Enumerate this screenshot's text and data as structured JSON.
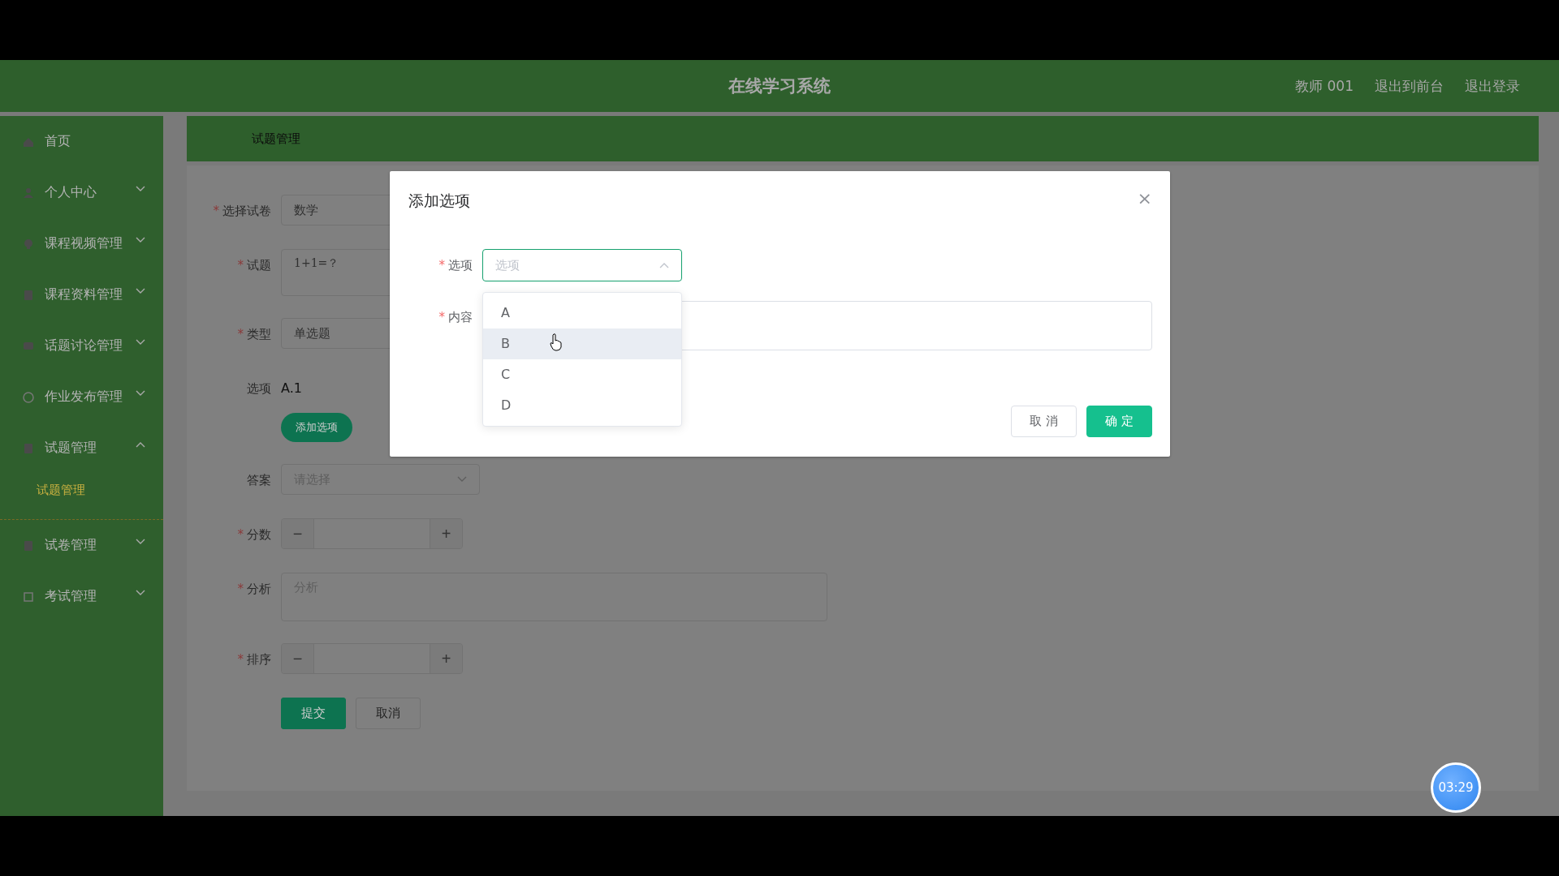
{
  "header": {
    "title": "在线学习系统",
    "user": "教师 001",
    "links": [
      "退出到前台",
      "退出登录"
    ]
  },
  "sidebar": {
    "items": [
      {
        "label": "首页",
        "expandable": false
      },
      {
        "label": "个人中心",
        "expandable": true,
        "expanded": false
      },
      {
        "label": "课程视频管理",
        "expandable": true,
        "expanded": false
      },
      {
        "label": "课程资料管理",
        "expandable": true,
        "expanded": false
      },
      {
        "label": "话题讨论管理",
        "expandable": true,
        "expanded": false
      },
      {
        "label": "作业发布管理",
        "expandable": true,
        "expanded": false
      },
      {
        "label": "试题管理",
        "expandable": true,
        "expanded": true,
        "children": [
          {
            "label": "试题管理",
            "selected": true
          }
        ]
      },
      {
        "label": "试卷管理",
        "expandable": true,
        "expanded": false
      },
      {
        "label": "考试管理",
        "expandable": true,
        "expanded": false
      }
    ]
  },
  "breadcrumb": "试题管理",
  "form": {
    "fields": [
      {
        "kind": "select",
        "mark": "*",
        "label": "选择试卷",
        "value": "数学"
      },
      {
        "kind": "textarea",
        "mark": "*",
        "label": "试题",
        "value": "1+1=？"
      },
      {
        "kind": "select",
        "mark": "*",
        "label": "类型",
        "value": "单选题"
      },
      {
        "kind": "static",
        "label": "选项",
        "value": "A.1",
        "button": "添加选项"
      },
      {
        "kind": "select",
        "label": "答案",
        "placeholder": "请选择"
      },
      {
        "kind": "number",
        "mark": "*",
        "label": "分数",
        "minus": "−",
        "plus": "+"
      },
      {
        "kind": "wide-textarea",
        "mark": "*",
        "label": "分析",
        "placeholder": "分析"
      },
      {
        "kind": "number",
        "mark": "*",
        "label": "排序",
        "minus": "−",
        "plus": "+"
      }
    ],
    "buttons": [
      {
        "label": "提交",
        "primary": true
      },
      {
        "label": "取消",
        "primary": false
      }
    ]
  },
  "dialog": {
    "title": "添加选项",
    "close": "×",
    "fields": [
      {
        "mark": "*",
        "label": "选项",
        "placeholder": "选项"
      },
      {
        "mark": "*",
        "label": "内容"
      }
    ],
    "dropdown": [
      {
        "label": "A",
        "highlighted": false
      },
      {
        "label": "B",
        "highlighted": true
      },
      {
        "label": "C",
        "highlighted": false
      },
      {
        "label": "D",
        "highlighted": false
      }
    ],
    "buttons": [
      {
        "label": "取 消",
        "primary": false
      },
      {
        "label": "确 定",
        "primary": true
      }
    ]
  },
  "timer": "03:29"
}
